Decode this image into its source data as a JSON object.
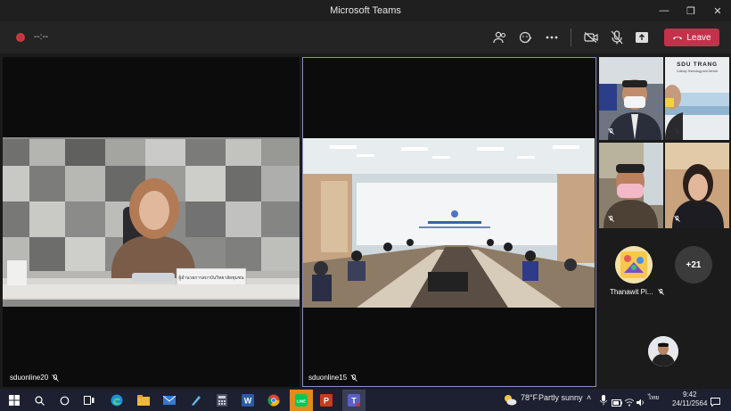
{
  "window": {
    "title": "Microsoft Teams"
  },
  "toolbar": {
    "timer": "--:--",
    "leave_label": "Leave"
  },
  "participants": {
    "main_left": {
      "name": "sduonline20",
      "nameplate": "ผู้อำนวยการสถาบันวิทยาลัยชุมชน"
    },
    "main_right": {
      "name": "sduonline15"
    },
    "thumb_logo_text": "SDU TRANG",
    "thumb_logo_sub": "Culinary Technology and Service",
    "thumb_named": {
      "name": "Thanawit Pi..."
    },
    "overflow_count": "+21"
  },
  "taskbar": {
    "weather_temp": "78°F",
    "weather_desc": "Partly sunny",
    "lang": "ไทย",
    "time": "9:42",
    "date": "24/11/2564"
  },
  "colors": {
    "leave": "#c4314b",
    "active_border": "#8b8cc7",
    "taskbar": "#1c2030"
  }
}
